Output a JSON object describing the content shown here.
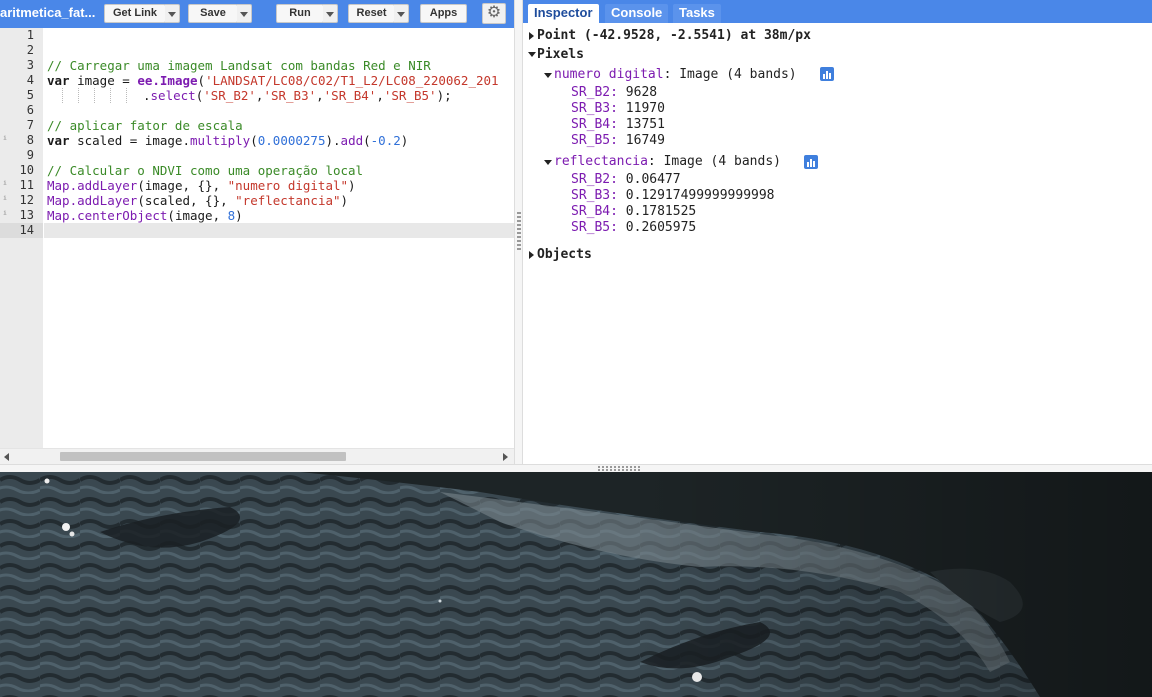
{
  "editor": {
    "script_title": "aritmetica_fat...",
    "buttons": {
      "get_link": "Get Link",
      "save": "Save",
      "run": "Run",
      "reset": "Reset",
      "apps": "Apps"
    },
    "line_numbers": [
      "1",
      "2",
      "3",
      "4",
      "5",
      "6",
      "7",
      "8",
      "9",
      "10",
      "11",
      "12",
      "13",
      "14"
    ],
    "code": {
      "l3": "// Carregar uma imagem Landsat com bandas Red e NIR",
      "l4_kw": "var",
      "l4_a": " image = ",
      "l4_ee": "ee.Image",
      "l4_b": "(",
      "l4_str": "'LANDSAT/LC08/C02/T1_L2/LC08_220062_201",
      "l5_a": ".",
      "l5_fn": "select",
      "l5_b": "(",
      "l5_s1": "'SR_B2'",
      "l5_c1": ",",
      "l5_s2": "'SR_B3'",
      "l5_c2": ",",
      "l5_s3": "'SR_B4'",
      "l5_c3": ",",
      "l5_s4": "'SR_B5'",
      "l5_end": ");",
      "l7": "// aplicar fator de escala",
      "l8_kw": "var",
      "l8_a": " scaled = image.",
      "l8_fn1": "multiply",
      "l8_b": "(",
      "l8_n1": "0.0000275",
      "l8_c": ").",
      "l8_fn2": "add",
      "l8_d": "(",
      "l8_n2": "-0.2",
      "l8_e": ")",
      "l10": "// Calcular o NDVI como uma operação local",
      "l11_fn": "Map.addLayer",
      "l11_a": "(image, {}, ",
      "l11_str": "\"numero digital\"",
      "l11_e": ")",
      "l12_fn": "Map.addLayer",
      "l12_a": "(scaled, {}, ",
      "l12_str": "\"reflectancia\"",
      "l12_e": ")",
      "l13_fn": "Map.centerObject",
      "l13_a": "(image, ",
      "l13_num": "8",
      "l13_e": ")"
    }
  },
  "right_panel": {
    "tabs": [
      "Inspector",
      "Console",
      "Tasks"
    ],
    "point_label": "Point (-42.9528, -2.5541) at 38m/px",
    "pixels_label": "Pixels",
    "objects_label": "Objects",
    "layers": [
      {
        "name": "numero digital",
        "desc": " Image (4 bands)",
        "bands": [
          {
            "key": "SR_B2:",
            "value": " 9628"
          },
          {
            "key": "SR_B3:",
            "value": " 11970"
          },
          {
            "key": "SR_B4:",
            "value": " 13751"
          },
          {
            "key": "SR_B5:",
            "value": " 16749"
          }
        ]
      },
      {
        "name": "reflectancia",
        "desc": " Image (4 bands)",
        "bands": [
          {
            "key": "SR_B2:",
            "value": " 0.06477"
          },
          {
            "key": "SR_B3:",
            "value": " 0.12917499999999998"
          },
          {
            "key": "SR_B4:",
            "value": " 0.1781525"
          },
          {
            "key": "SR_B5:",
            "value": " 0.2605975"
          }
        ]
      }
    ]
  },
  "colors": {
    "toolbar_blue": "#4a87e8",
    "comment_green": "#3a8a27",
    "string_red": "#c4382c",
    "function_purple": "#7c1bb0",
    "number_blue": "#3070d8"
  },
  "icons": [
    "dropdown-arrow-icon",
    "gear-icon",
    "chart-icon",
    "expand-arrow-icon",
    "collapse-arrow-icon"
  ]
}
